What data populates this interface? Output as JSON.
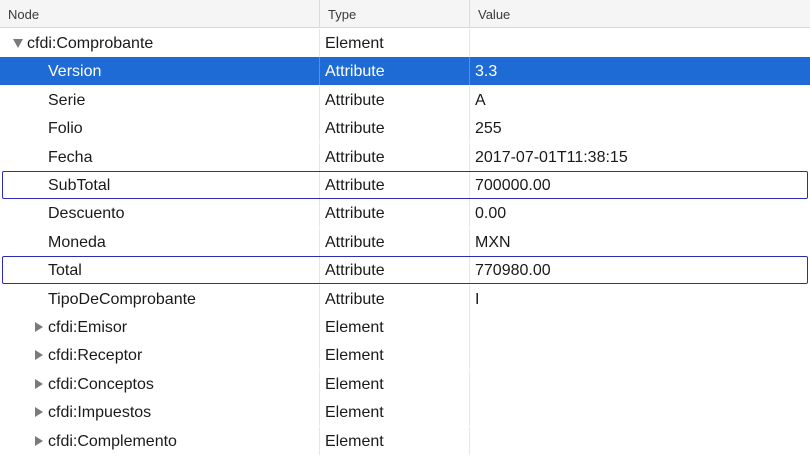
{
  "columns": {
    "node": "Node",
    "type": "Type",
    "value": "Value"
  },
  "rows": [
    {
      "node": "cfdi:Comprobante",
      "type": "Element",
      "value": "",
      "disclosure": "expanded",
      "depth": 0
    },
    {
      "node": "Version",
      "type": "Attribute",
      "value": "3.3",
      "disclosure": "none",
      "depth": 1,
      "selected": true
    },
    {
      "node": "Serie",
      "type": "Attribute",
      "value": "A",
      "disclosure": "none",
      "depth": 1
    },
    {
      "node": "Folio",
      "type": "Attribute",
      "value": "255",
      "disclosure": "none",
      "depth": 1
    },
    {
      "node": "Fecha",
      "type": "Attribute",
      "value": "2017-07-01T11:38:15",
      "disclosure": "none",
      "depth": 1
    },
    {
      "node": "SubTotal",
      "type": "Attribute",
      "value": "700000.00",
      "disclosure": "none",
      "depth": 1,
      "highlighted": true
    },
    {
      "node": "Descuento",
      "type": "Attribute",
      "value": "0.00",
      "disclosure": "none",
      "depth": 1
    },
    {
      "node": "Moneda",
      "type": "Attribute",
      "value": "MXN",
      "disclosure": "none",
      "depth": 1
    },
    {
      "node": "Total",
      "type": "Attribute",
      "value": "770980.00",
      "disclosure": "none",
      "depth": 1,
      "highlighted": true
    },
    {
      "node": "TipoDeComprobante",
      "type": "Attribute",
      "value": "I",
      "disclosure": "none",
      "depth": 1
    },
    {
      "node": "cfdi:Emisor",
      "type": "Element",
      "value": "",
      "disclosure": "collapsed",
      "depth": 1
    },
    {
      "node": "cfdi:Receptor",
      "type": "Element",
      "value": "",
      "disclosure": "collapsed",
      "depth": 1
    },
    {
      "node": "cfdi:Conceptos",
      "type": "Element",
      "value": "",
      "disclosure": "collapsed",
      "depth": 1
    },
    {
      "node": "cfdi:Impuestos",
      "type": "Element",
      "value": "",
      "disclosure": "collapsed",
      "depth": 1
    },
    {
      "node": "cfdi:Complemento",
      "type": "Element",
      "value": "",
      "disclosure": "collapsed",
      "depth": 1
    }
  ],
  "colors": {
    "selection": "#1f6bd6",
    "highlight_border": "#2b2bb8",
    "header_bg": "#f5f5f5"
  },
  "icons": {
    "expanded": "disclosure-triangle-down-icon",
    "collapsed": "disclosure-triangle-right-icon"
  }
}
